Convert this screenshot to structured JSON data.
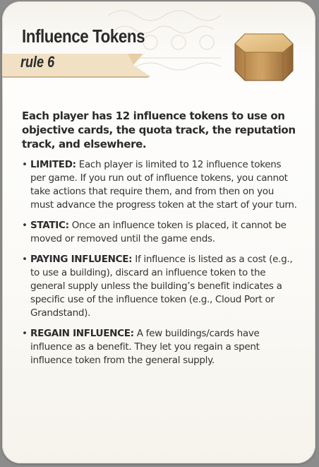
{
  "card": {
    "title": "Influence Tokens",
    "rule_label": "rule 6",
    "token_icon": "wooden-octagon-token-icon",
    "intro": "Each player has 12 influence tokens to use on objective cards, the quota track, the reputation track, and elsewhere.",
    "rules": [
      {
        "term": "LIMITED:",
        "text": " Each player is limited to 12 influence tokens per game. If you run out of influence tokens, you cannot take actions that require them, and from then on you must advance the progress token at the start of your turn."
      },
      {
        "term": "STATIC:",
        "text": " Once an influence token is placed, it cannot be moved or removed until the game ends."
      },
      {
        "term": "PAYING INFLUENCE:",
        "text": " If influence is listed as a cost (e.g., to use a building), discard an influence token to the general supply unless the building’s benefit indicates a specific use of the influence token (e.g., Cloud Port or Grandstand)."
      },
      {
        "term": "REGAIN INFLUENCE:",
        "text": " A few buildings/cards have influence as a benefit. They let you regain a spent influence token from the general supply."
      }
    ]
  },
  "colors": {
    "banner": "#f1e0c3",
    "banner_shadow": "#ccb48e",
    "token_top": "#e7c48a",
    "token_side": "#b98a50",
    "text": "#2b2b2b"
  }
}
